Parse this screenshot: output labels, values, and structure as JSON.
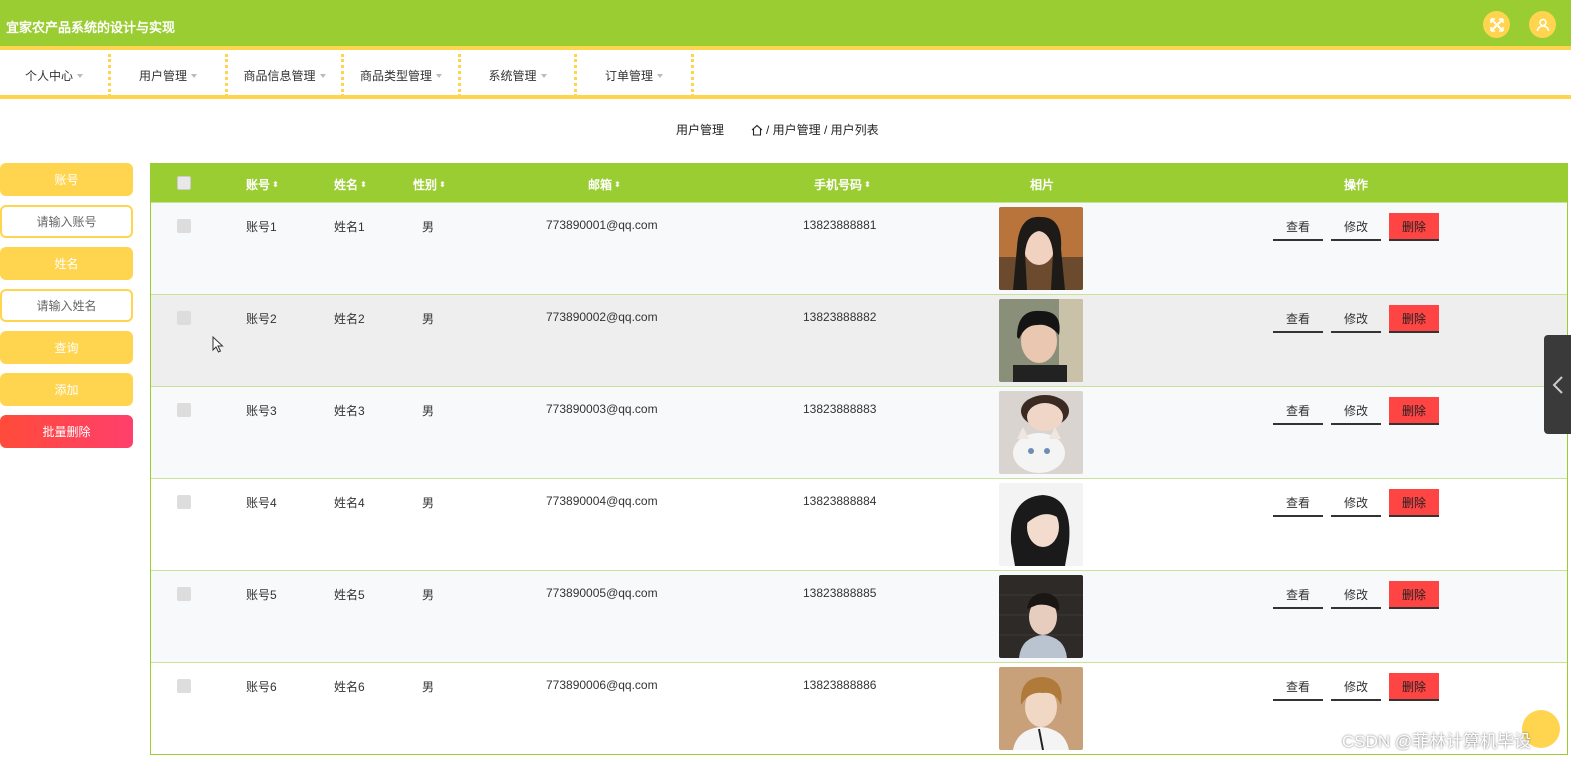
{
  "app": {
    "title": "宜家农产品系统的设计与实现"
  },
  "nav": {
    "items": [
      {
        "label": "个人中心"
      },
      {
        "label": "用户管理"
      },
      {
        "label": "商品信息管理"
      },
      {
        "label": "商品类型管理"
      },
      {
        "label": "系统管理"
      },
      {
        "label": "订单管理"
      }
    ]
  },
  "breadcrumb": {
    "current": "用户管理",
    "path": "/ 用户管理 / 用户列表"
  },
  "search": {
    "account_label": "账号",
    "account_placeholder": "请输入账号",
    "name_label": "姓名",
    "name_placeholder": "请输入姓名",
    "query_label": "查询",
    "add_label": "添加",
    "batch_delete_label": "批量删除"
  },
  "table": {
    "columns": {
      "account": "账号",
      "name": "姓名",
      "gender": "性别",
      "email": "邮箱",
      "phone": "手机号码",
      "photo": "相片",
      "actions": "操作"
    },
    "actions": {
      "view": "查看",
      "edit": "修改",
      "delete": "删除"
    },
    "rows": [
      {
        "account": "账号1",
        "name": "姓名1",
        "gender": "男",
        "email": "773890001@qq.com",
        "phone": "13823888881"
      },
      {
        "account": "账号2",
        "name": "姓名2",
        "gender": "男",
        "email": "773890002@qq.com",
        "phone": "13823888882"
      },
      {
        "account": "账号3",
        "name": "姓名3",
        "gender": "男",
        "email": "773890003@qq.com",
        "phone": "13823888883"
      },
      {
        "account": "账号4",
        "name": "姓名4",
        "gender": "男",
        "email": "773890004@qq.com",
        "phone": "13823888884"
      },
      {
        "account": "账号5",
        "name": "姓名5",
        "gender": "男",
        "email": "773890005@qq.com",
        "phone": "13823888885"
      },
      {
        "account": "账号6",
        "name": "姓名6",
        "gender": "男",
        "email": "773890006@qq.com",
        "phone": "13823888886"
      }
    ]
  },
  "watermark": "CSDN @菲林计算机毕设",
  "colors": {
    "primary": "#9acd32",
    "accent": "#ffd54f",
    "danger": "#ff4444"
  }
}
